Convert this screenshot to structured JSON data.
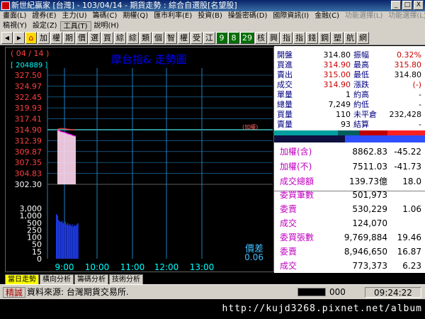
{
  "window": {
    "title": "新世紀贏家 [台灣] - 103/04/14 - 期貨走勢 : 綜合自選股[名望股]",
    "buttons": [
      "_",
      "□",
      "X"
    ]
  },
  "menu": {
    "row1": [
      "畫面(L)",
      "證券(E)",
      "主力(U)",
      "籌碼(C)",
      "期權(Q)",
      "匯市利率(E)",
      "投資(B)",
      "操盤密碼(D)",
      "國際資訊(I)",
      "金融(C)",
      "功能選擇(L)",
      "功能選擇(L)"
    ],
    "row2": [
      "稿視(Y)",
      "設定(Z)",
      "工具(T)",
      "說明(H)"
    ]
  },
  "toolbar": {
    "items": [
      "加",
      "權",
      "期",
      "價",
      "選",
      "買",
      "綜",
      "綜",
      "類",
      "個",
      "智",
      "權",
      "受",
      "江",
      "9",
      "8",
      "29",
      "核",
      "興",
      "指",
      "指",
      "錢",
      "鋼",
      "塑",
      "航",
      "網"
    ]
  },
  "chart_data": {
    "type": "line",
    "date_label": "( 04 / 14 )",
    "volume_label": "[ 204889 ]",
    "title": "摩台指&  走勢圖",
    "y_ticks": [
      "327.50",
      "324.97",
      "322.45",
      "319.93",
      "317.41",
      "314.90",
      "312.39",
      "309.87",
      "307.35",
      "304.83",
      "302.30"
    ],
    "reference_price": 314.9,
    "ylim": [
      302.3,
      327.5
    ],
    "volume_ticks": [
      "3,000",
      "1,000",
      "500",
      "250",
      "100",
      "50",
      "15",
      "0"
    ],
    "x_ticks": [
      "9:00",
      "10:00",
      "11:00",
      "12:00",
      "13:00"
    ],
    "right_note": "(加權)",
    "diff_label": "價差",
    "diff_value": "0.06",
    "price_series": {
      "name": "摩台指",
      "values": [
        315.0,
        315.1,
        315.2,
        315.2,
        315.1,
        315.1,
        315.0,
        315.0,
        314.9,
        314.9,
        314.9,
        314.9
      ]
    },
    "weighted_series": {
      "name": "加權",
      "values": [
        314.9,
        314.7,
        314.5,
        314.4,
        314.3,
        314.2,
        314.0,
        313.9,
        313.8,
        313.6,
        313.5,
        313.4
      ]
    },
    "volume_bars": [
      1000,
      800,
      400,
      320,
      300,
      350,
      250,
      220,
      300,
      200,
      250,
      180,
      220,
      160,
      200,
      140,
      180,
      160,
      200,
      240
    ]
  },
  "quote": {
    "rows": [
      {
        "l1": "開盤",
        "v1": "314.80",
        "c1": "val",
        "l2": "振幅",
        "v2": "0.32%",
        "c2": "red"
      },
      {
        "l1": "買進",
        "v1": "314.90",
        "c1": "red",
        "l2": "最高",
        "v2": "315.80",
        "c2": "red"
      },
      {
        "l1": "賣出",
        "v1": "315.00",
        "c1": "red",
        "l2": "最低",
        "v2": "314.80",
        "c2": "val"
      },
      {
        "l1": "成交",
        "v1": "314.90",
        "c1": "red",
        "l2": "漲跌",
        "v2": "(-)",
        "c2": "red"
      },
      {
        "l1": "單量",
        "v1": "1",
        "c1": "val",
        "l2": "約高",
        "v2": "-",
        "c2": "val"
      },
      {
        "l1": "總量",
        "v1": "7,249",
        "c1": "val",
        "l2": "約低",
        "v2": "-",
        "c2": "val"
      },
      {
        "l1": "買量",
        "v1": "110",
        "c1": "val",
        "l2": "未平倉",
        "v2": "232,428",
        "c2": "val"
      },
      {
        "l1": "賣量",
        "v1": "93",
        "c1": "val",
        "l2": "結算",
        "v2": "-",
        "c2": "val"
      }
    ]
  },
  "index_panel": {
    "rows": [
      {
        "label": "加權(含)",
        "value": "8862.83",
        "change": "-45.22"
      },
      {
        "label": "加權(不)",
        "value": "7511.03",
        "change": "-41.73"
      },
      {
        "label": "成交總額",
        "value": "139.73億",
        "change": "18.0"
      }
    ]
  },
  "order_panel": {
    "rows": [
      {
        "label": "委買筆數",
        "value": "501,973",
        "change": ""
      },
      {
        "label": "委賣",
        "value": "530,229",
        "change": "1.06"
      },
      {
        "label": "成交",
        "value": "124,070",
        "change": ""
      },
      {
        "label": "委買張數",
        "value": "9,769,884",
        "change": "19.46"
      },
      {
        "label": "委賣",
        "value": "8,946,650",
        "change": "16.87"
      },
      {
        "label": "成交",
        "value": "773,373",
        "change": "6.23"
      }
    ]
  },
  "tabs": [
    "當日走勢",
    "橫向分析",
    "籌碼分析",
    "技術分析"
  ],
  "status": {
    "label": "精誠",
    "text": "資料來源: 台灣期貨交易所.",
    "count": "000",
    "time": "09:24:22"
  },
  "watermark": "http://kujd3268.pixnet.net/album",
  "colors": {
    "price_line": "#ff4040",
    "weighted_line": "#ff00ff",
    "grid": "#2080c0",
    "ref_line": "#40c0c0",
    "volume": "#2040ff",
    "title": "#0000ff",
    "diff": "#40c0ff"
  }
}
